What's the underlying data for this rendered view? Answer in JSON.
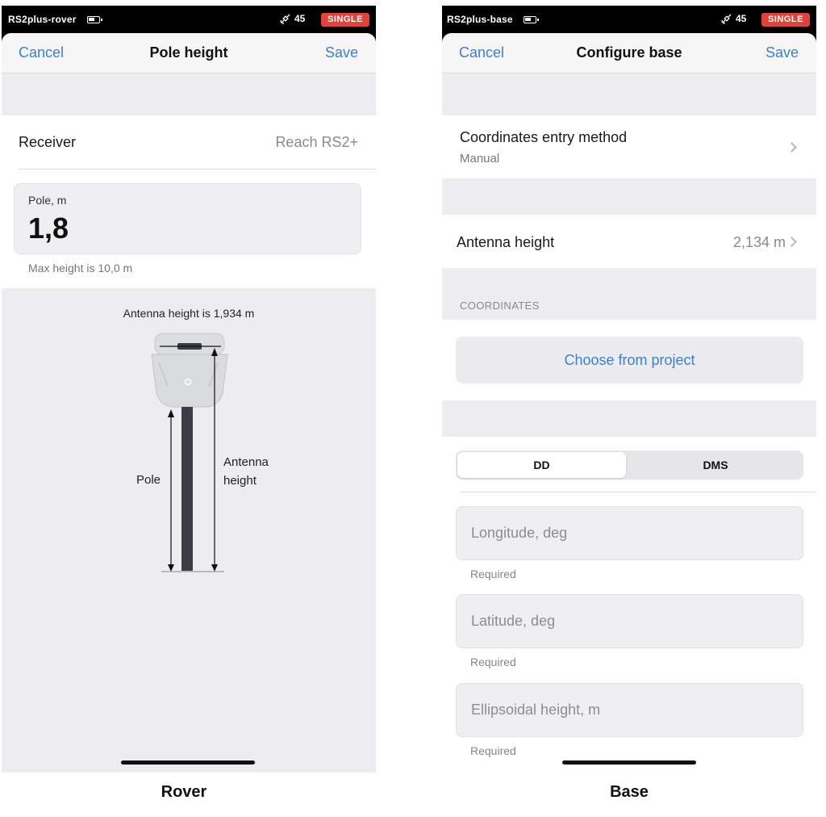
{
  "rover": {
    "status": {
      "device": "RS2plus-rover",
      "sat_count": "45",
      "mode": "SINGLE"
    },
    "nav": {
      "cancel": "Cancel",
      "title": "Pole height",
      "save": "Save"
    },
    "receiver": {
      "label": "Receiver",
      "value": "Reach RS2+"
    },
    "pole_field": {
      "label": "Pole, m",
      "value": "1,8",
      "hint": "Max height is 10,0 m"
    },
    "diagram": {
      "antenna_height_text": "Antenna height is 1,934 m",
      "pole_label": "Pole",
      "antenna_label_line1": "Antenna",
      "antenna_label_line2": "height"
    },
    "caption": "Rover"
  },
  "base": {
    "status": {
      "device": "RS2plus-base",
      "sat_count": "45",
      "mode": "SINGLE"
    },
    "nav": {
      "cancel": "Cancel",
      "title": "Configure base",
      "save": "Save"
    },
    "entry_method": {
      "label": "Coordinates entry method",
      "value": "Manual"
    },
    "antenna": {
      "label": "Antenna height",
      "value": "2,134 m"
    },
    "section_header": "COORDINATES",
    "choose_button": "Choose from project",
    "segments": [
      {
        "label": "DD",
        "selected": true
      },
      {
        "label": "DMS",
        "selected": false
      }
    ],
    "fields": [
      {
        "placeholder": "Longitude, deg",
        "hint": "Required"
      },
      {
        "placeholder": "Latitude, deg",
        "hint": "Required"
      },
      {
        "placeholder": "Ellipsoidal height, m",
        "hint": "Required"
      }
    ],
    "caption": "Base"
  },
  "colors": {
    "accent": "#3b7fd4",
    "badge": "#e0433b",
    "pole": "#3a3d45"
  },
  "icons": {
    "satellite": "satellite-icon",
    "battery": "battery-icon",
    "chevron": "chevron-right-icon"
  }
}
